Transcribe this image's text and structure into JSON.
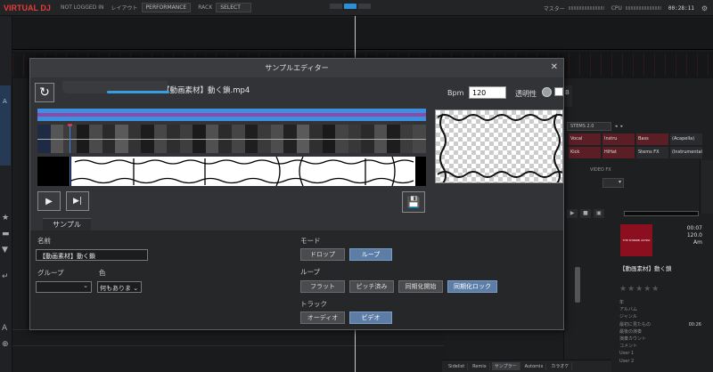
{
  "topbar": {
    "logo": "VIRTUAL DJ",
    "login": "NOT LOGGED IN",
    "layout_label": "レイアウト",
    "layout_value": "PERFORMANCE",
    "rack_label": "RACK",
    "rack_value": "SELECT",
    "master_label": "マスター",
    "cpu_label": "CPU",
    "clock": "00:28:11"
  },
  "background": {
    "deck_a": "A",
    "deck_b": "B",
    "stems_select": "STEMS 2.0",
    "stems": [
      "Vocal",
      "Instru",
      "Bass",
      "(Acapella)",
      "Kick",
      "HiHat",
      "Stems FX",
      "(Instrumental)"
    ],
    "video_fx": "VIDEO FX",
    "track_title": "【動画素材】動く鎖",
    "cover_text": "THE SHINOBI ASTRO",
    "time": "00:07",
    "bpm_value": "120.0",
    "key": "Am",
    "info_fields": [
      {
        "label": "年",
        "value": ""
      },
      {
        "label": "アルバム",
        "value": ""
      },
      {
        "label": "ジャンル",
        "value": ""
      },
      {
        "label": "最初に見たもの",
        "value": "00:26"
      },
      {
        "label": "最後の演奏",
        "value": ""
      },
      {
        "label": "演奏カウント",
        "value": ""
      },
      {
        "label": "コメント",
        "value": ""
      },
      {
        "label": "User 1",
        "value": ""
      },
      {
        "label": "User 2",
        "value": ""
      }
    ],
    "bottom_tabs": [
      "Sidelist",
      "Remix",
      "サンプラー",
      "Automix",
      "カラオケ"
    ]
  },
  "dialog": {
    "title": "サンプルエディター",
    "file_name": "【動画素材】動く鎖.mp4",
    "bpm_label": "Bpm",
    "bpm_value": "120",
    "opacity_label": "透明性",
    "tab_label": "サンプル",
    "name_label": "名前",
    "name_value": "【動画素材】動く鎖",
    "group_label": "グループ",
    "color_label": "色",
    "color_value": "何もありま",
    "mode_label": "モード",
    "mode_options": [
      {
        "label": "ドロップ",
        "active": false
      },
      {
        "label": "ループ",
        "active": true
      }
    ],
    "loop_label": "ループ",
    "loop_options": [
      {
        "label": "フラット",
        "active": false
      },
      {
        "label": "ピッチ済み",
        "active": false
      },
      {
        "label": "同期化開始",
        "active": false
      },
      {
        "label": "同期化ロック",
        "active": true
      }
    ],
    "track_label": "トラック",
    "track_options": [
      {
        "label": "オーディオ",
        "active": false
      },
      {
        "label": "ビデオ",
        "active": true
      }
    ]
  }
}
